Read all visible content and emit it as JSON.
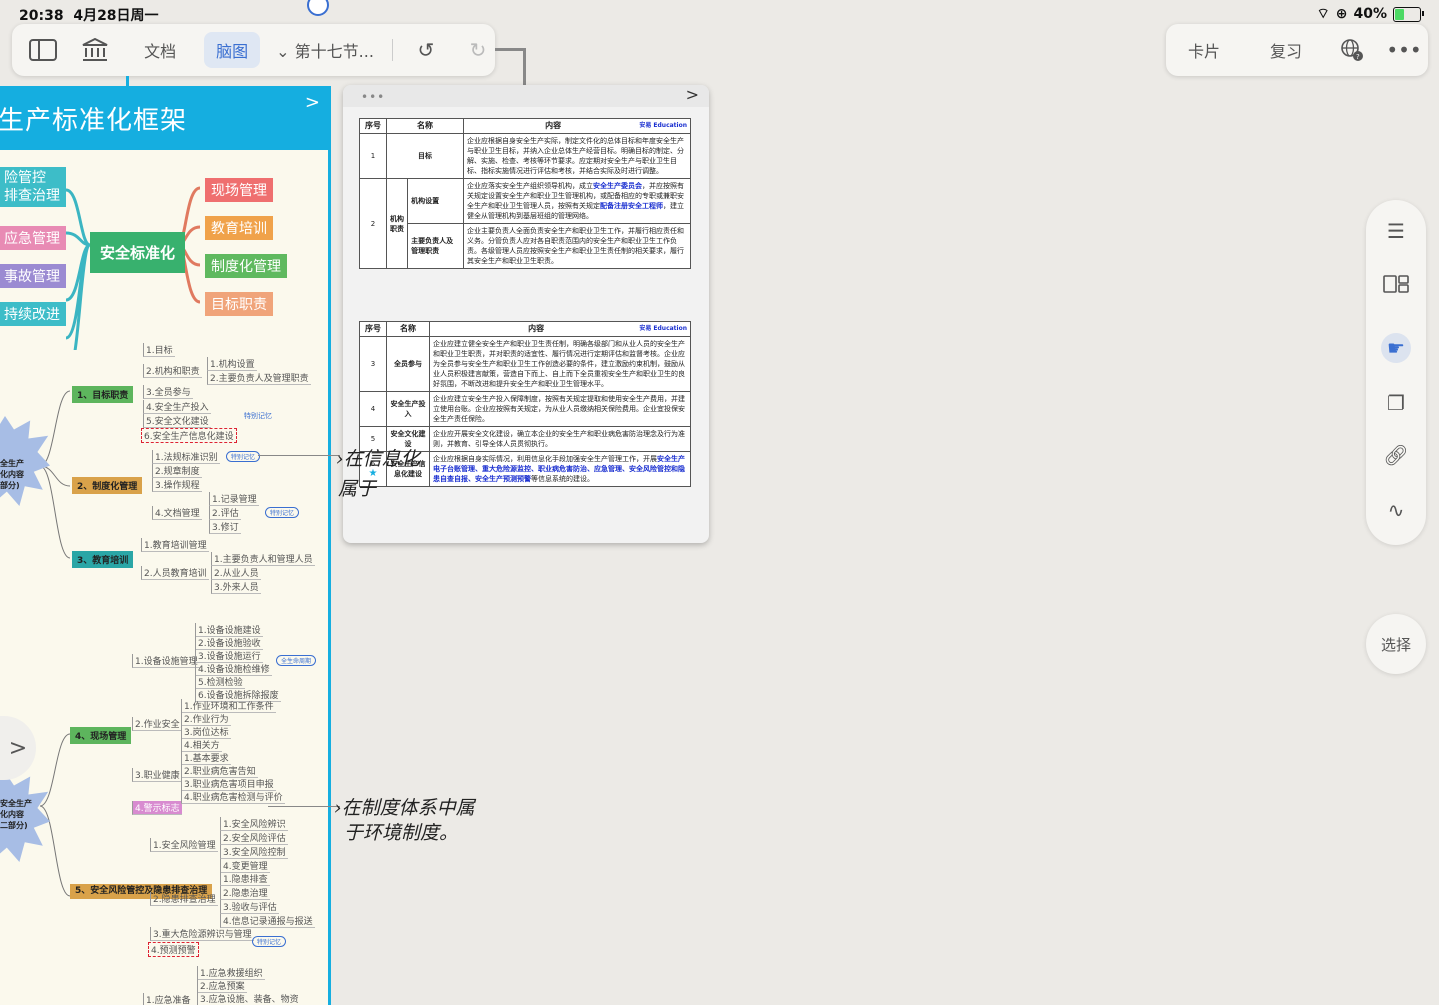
{
  "status": {
    "time": "20:38",
    "date": "4月28日周一",
    "battery": "40%",
    "battery_level": 0.4
  },
  "toolbar": {
    "doc_label": "文档",
    "mindmap_label": "脑图",
    "section_label": "第十七节...",
    "card_label": "卡片",
    "review_label": "复习"
  },
  "mindmap": {
    "title": "生产标准化框架",
    "center": "安全标准化",
    "left_boxes": [
      "险管控",
      "排查治理",
      "应急管理",
      "事故管理",
      "持续改进"
    ],
    "right_boxes": [
      "现场管理",
      "教育培训",
      "制度化管理",
      "目标职责"
    ],
    "burst1": [
      "全生产",
      "化内容",
      "部分)"
    ],
    "burst2": [
      "安全生产",
      "化内容",
      "二部分)"
    ],
    "tags": {
      "special": "特别记忆",
      "lifecycle": "全生命周期"
    },
    "sec1": {
      "title": "1、目标职责",
      "items": [
        "1.目标",
        "2.机构和职责",
        "3.全员参与",
        "4.安全生产投入",
        "5.安全文化建设",
        "6.安全生产信息化建设"
      ],
      "sub": [
        "1.机构设置",
        "2.主要负责人及管理职责"
      ]
    },
    "sec2": {
      "title": "2、制度化管理",
      "items": [
        "1.法规标准识别",
        "2.规章制度",
        "3.操作规程",
        "4.文档管理"
      ],
      "sub": [
        "1.记录管理",
        "2.评估",
        "3.修订"
      ]
    },
    "sec3": {
      "title": "3、教育培训",
      "items": [
        "1.教育培训管理",
        "2.人员教育培训"
      ],
      "sub": [
        "1.主要负责人和管理人员",
        "2.从业人员",
        "3.外来人员"
      ]
    },
    "sec4": {
      "title": "4、现场管理",
      "items": [
        "1.设备设施管理",
        "2.作业安全",
        "3.职业健康",
        "4.警示标志"
      ],
      "sub1": [
        "1.设备设施建设",
        "2.设备设施验收",
        "3.设备设施运行",
        "4.设备设施检维修",
        "5.检测检验",
        "6.设备设施拆除报废"
      ],
      "sub2": [
        "1.作业环境和工作条件",
        "2.作业行为",
        "3.岗位达标",
        "4.相关方"
      ],
      "sub3": [
        "1.基本要求",
        "2.职业病危害告知",
        "3.职业病危害项目申报",
        "4.职业病危害检测与评价"
      ]
    },
    "sec5": {
      "title": "5、安全风险管控及隐患排查治理",
      "items": [
        "1.安全风险管理",
        "2.隐患排查治理",
        "3.重大危险源辨识与管理",
        "4.预测预警"
      ],
      "sub1": [
        "1.安全风险辨识",
        "2.安全风险评估",
        "3.安全风险控制",
        "4.变更管理"
      ],
      "sub2": [
        "1.隐患排查",
        "2.隐患治理",
        "3.验收与评估",
        "4.信息记录通报与报送"
      ]
    },
    "sec6": {
      "items": [
        "1.应急准备"
      ],
      "sub": [
        "1.应急救援组织",
        "2.应急预案",
        "3.应急设施、装备、物资"
      ]
    }
  },
  "doc": {
    "headers": [
      "序号",
      "名称",
      "内容"
    ],
    "logo": "安易 Education",
    "rows1": [
      {
        "no": "1",
        "name": "目标",
        "content": "企业应根据自身安全生产实际，制定文件化的总体目标和年度安全生产与职业卫生目标，并纳入企业总体生产经营目标。明确目标的制定、分解、实施、检查、考核等环节要求。应定期对安全生产与职业卫生目标、指标实施情况进行评估和考核，并结合实际及时进行调整。"
      },
      {
        "no": "2",
        "name": "机构职责",
        "sub1": "机构设置",
        "sub1_content_a": "企业应落实安全生产组织领导机构，成立",
        "sub1_hl1": "安全生产委员会",
        "sub1_content_b": "，并应按照有关规定设置安全生产和职业卫生管理机构，或配备相应的专职或兼职安全生产和职业卫生管理人员，按照有关规定",
        "sub1_hl2": "配备注册安全工程师",
        "sub1_content_c": "，建立健全从管理机构到基层班组的管理网络。",
        "sub2": "主要负责人及管理职责",
        "sub2_content": "企业主要负责人全面负责安全生产和职业卫生工作，并履行相应责任和义务。分管负责人应对各自职责范围内的安全生产和职业卫生工作负责。各级管理人员应按照安全生产和职业卫生责任制的相关要求，履行其安全生产和职业卫生职责。"
      }
    ],
    "rows2": [
      {
        "no": "3",
        "name": "全员参与",
        "content": "企业应建立健全安全生产和职业卫生责任制，明确各级部门和从业人员的安全生产和职业卫生职责，并对职责的适宜性、履行情况进行定期评估和监督考核。企业应为全员参与安全生产和职业卫生工作创造必要的条件，建立激励约束机制，鼓励从业人员积极建言献策，营造自下而上、自上而下全员重视安全生产和职业卫生的良好氛围，不断改进和提升安全生产和职业卫生管理水平。"
      },
      {
        "no": "4",
        "name": "安全生产投入",
        "content": "企业应建立安全生产投入保障制度，按照有关规定提取和使用安全生产费用，并建立使用台账。企业应按照有关规定，为从业人员缴纳相关保险费用。企业宜投保安全生产责任保险。"
      },
      {
        "no": "5",
        "name": "安全文化建设",
        "content": "企业应开展安全文化建设，确立本企业的安全生产和职业病危害防治理念及行为准则，并教育、引导全体人员贯彻执行。"
      },
      {
        "no": "6",
        "name": "安全生产信息化建设",
        "content_a": "企业应根据自身实际情况，利用信息化手段加强安全生产管理工作，开展",
        "hl": "安全生产电子台账管理、重大危险源监控、职业病危害防治、应急管理、安全风险管控和隐患自查自报、安全生产预测预警",
        "content_b": "等信息系统的建设。"
      }
    ]
  },
  "handwriting": {
    "note1_line1": "在信息化",
    "note1_line2": "属于",
    "note2_line1": "在制度体系中属",
    "note2_line2": "于环境制度。"
  },
  "rail": {
    "select_label": "选择"
  }
}
